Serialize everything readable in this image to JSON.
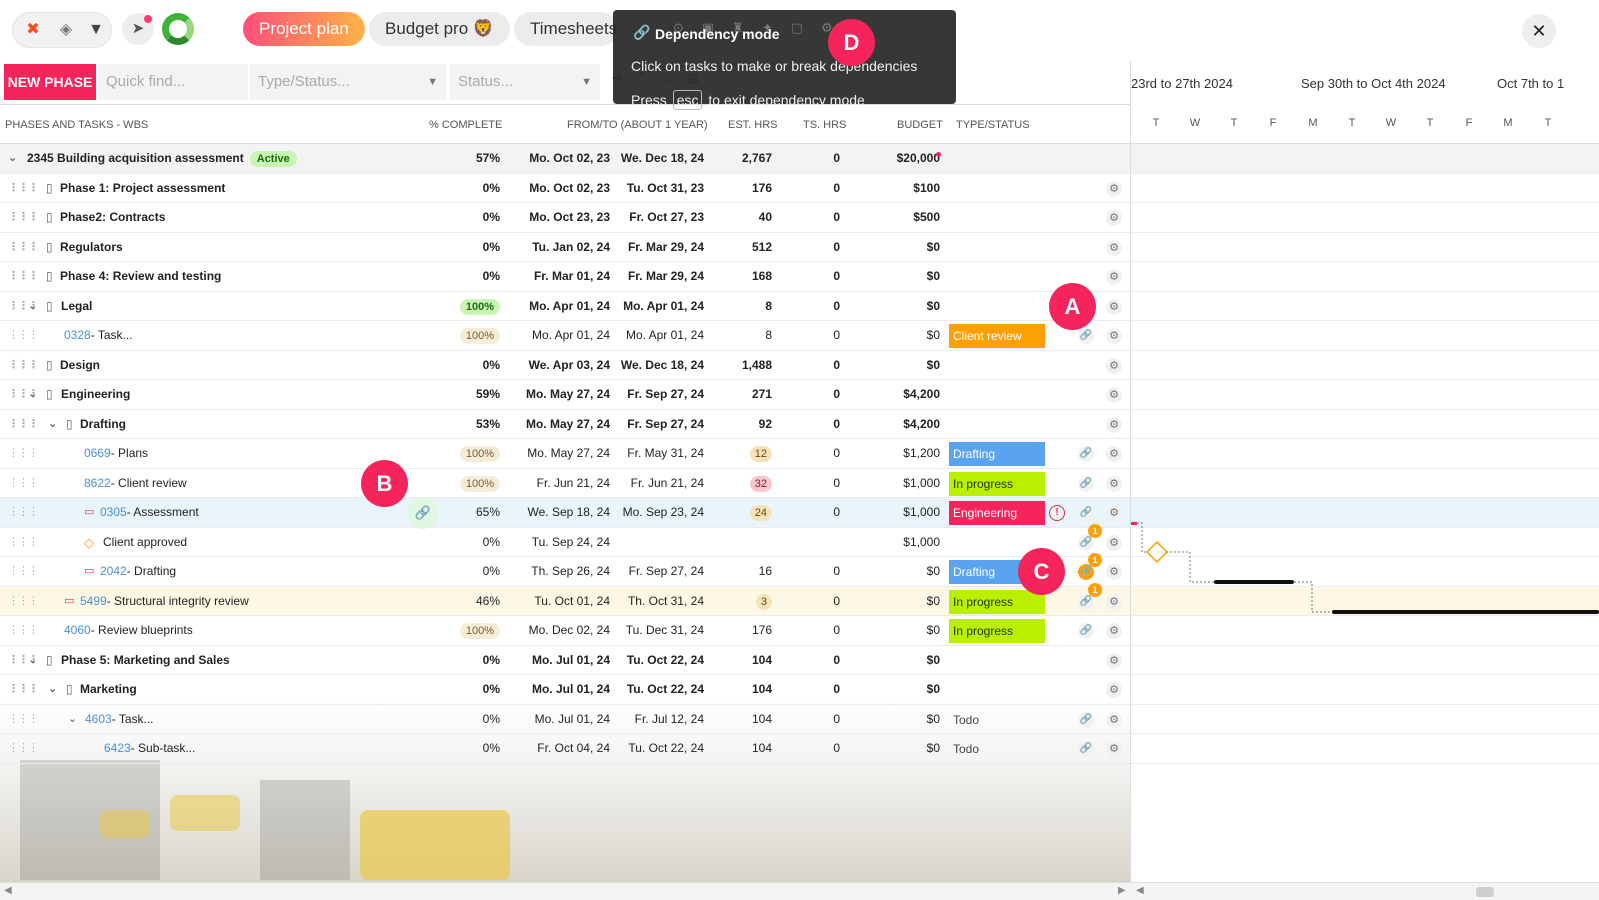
{
  "topbar": {
    "tabs": [
      {
        "label": "Project plan",
        "active": true
      },
      {
        "label": "Budget pro 🦁",
        "active": false
      },
      {
        "label": "Timesheets",
        "active": false
      }
    ],
    "icons": [
      "x-logo-icon",
      "layers-icon",
      "chevron-down-icon",
      "rocket-icon",
      "spinner-icon",
      "close-icon"
    ],
    "close_label": "✕"
  },
  "filters": {
    "new_phase_label": "NEW PHASE",
    "quick_find_placeholder": "Quick find...",
    "type_status_placeholder": "Type/Status...",
    "status_placeholder": "Status..."
  },
  "columns": {
    "wbs": "PHASES AND TASKS - WBS",
    "complete": "% COMPLETE",
    "fromto": "FROM/TO (ABOUT 1 YEAR)",
    "est": "EST. HRS",
    "ts": "TS. HRS",
    "budget": "BUDGET",
    "type": "TYPE/STATUS"
  },
  "gantt": {
    "weeks": [
      "23rd to 27th 2024",
      "Sep 30th to Oct 4th 2024",
      "Oct 7th to 1"
    ],
    "days": [
      "T",
      "W",
      "T",
      "F",
      "M",
      "T",
      "W",
      "T",
      "F",
      "M",
      "T"
    ]
  },
  "tooltip": {
    "title": "Dependency mode",
    "body": "Click on tasks to make or break dependencies",
    "esc_pre": "Press",
    "esc_key": "esc",
    "esc_post": "to exit dependency mode"
  },
  "markers": {
    "a": "A",
    "b": "B",
    "c": "C",
    "d": "D"
  },
  "rows": [
    {
      "name": "2345 Building acquisition assessment",
      "tag": "Active",
      "pct": "57%",
      "from": "Mo. Oct 02, 23",
      "to": "We. Dec 18, 24",
      "est": "2,767",
      "ts": "0",
      "budget": "$20,000"
    },
    {
      "name": "Phase 1: Project assessment",
      "pct": "0%",
      "from": "Mo. Oct 02, 23",
      "to": "Tu. Oct 31, 23",
      "est": "176",
      "ts": "0",
      "budget": "$100"
    },
    {
      "name": "Phase2: Contracts",
      "pct": "0%",
      "from": "Mo. Oct 23, 23",
      "to": "Fr. Oct 27, 23",
      "est": "40",
      "ts": "0",
      "budget": "$500"
    },
    {
      "name": "Regulators",
      "pct": "0%",
      "from": "Tu. Jan 02, 24",
      "to": "Fr. Mar 29, 24",
      "est": "512",
      "ts": "0",
      "budget": "$0"
    },
    {
      "name": "Phase 4: Review and testing",
      "pct": "0%",
      "from": "Fr. Mar 01, 24",
      "to": "Fr. Mar 29, 24",
      "est": "168",
      "ts": "0",
      "budget": "$0"
    },
    {
      "name": "Legal",
      "pct": "100%",
      "from": "Mo. Apr 01, 24",
      "to": "Mo. Apr 01, 24",
      "est": "8",
      "ts": "0",
      "budget": "$0"
    },
    {
      "num": "0328",
      "name": "- Task...",
      "pct": "100%",
      "from": "Mo. Apr 01, 24",
      "to": "Mo. Apr 01, 24",
      "est": "8",
      "ts": "0",
      "budget": "$0",
      "status": "Client review"
    },
    {
      "name": "Design",
      "pct": "0%",
      "from": "We. Apr 03, 24",
      "to": "We. Dec 18, 24",
      "est": "1,488",
      "ts": "0",
      "budget": "$0"
    },
    {
      "name": "Engineering",
      "pct": "59%",
      "from": "Mo. May 27, 24",
      "to": "Fr. Sep 27, 24",
      "est": "271",
      "ts": "0",
      "budget": "$4,200"
    },
    {
      "name": "Drafting",
      "pct": "53%",
      "from": "Mo. May 27, 24",
      "to": "Fr. Sep 27, 24",
      "est": "92",
      "ts": "0",
      "budget": "$4,200"
    },
    {
      "num": "0669",
      "name": "- Plans",
      "pct": "100%",
      "from": "Mo. May 27, 24",
      "to": "Fr. May 31, 24",
      "est": "12",
      "ts": "0",
      "budget": "$1,200",
      "status": "Drafting"
    },
    {
      "num": "8622",
      "name": "- Client review",
      "pct": "100%",
      "from": "Fr. Jun 21, 24",
      "to": "Fr. Jun 21, 24",
      "est": "32",
      "ts": "0",
      "budget": "$1,000",
      "status": "In progress"
    },
    {
      "num": "0305",
      "name": "- Assessment",
      "pct": "65%",
      "from": "We. Sep 18, 24",
      "to": "Mo. Sep 23, 24",
      "est": "24",
      "ts": "0",
      "budget": "$1,000",
      "status": "Engineering",
      "alert": "!"
    },
    {
      "name": "Client approved",
      "pct": "0%",
      "from": "Tu. Sep 24, 24",
      "to": "",
      "est": "",
      "ts": "",
      "budget": "$1,000",
      "badge": "1"
    },
    {
      "num": "2042",
      "name": "- Drafting",
      "pct": "0%",
      "from": "Th. Sep 26, 24",
      "to": "Fr. Sep 27, 24",
      "est": "16",
      "ts": "0",
      "budget": "$0",
      "status": "Drafting",
      "badge": "1"
    },
    {
      "num": "5499",
      "name": "- Structural integrity review",
      "pct": "46%",
      "from": "Tu. Oct 01, 24",
      "to": "Th. Oct 31, 24",
      "est": "3",
      "ts": "0",
      "budget": "$0",
      "status": "In progress",
      "badge": "1"
    },
    {
      "num": "4060",
      "name": "- Review blueprints",
      "pct": "100%",
      "from": "Mo. Dec 02, 24",
      "to": "Tu. Dec 31, 24",
      "est": "176",
      "ts": "0",
      "budget": "$0",
      "status": "In progress"
    },
    {
      "name": "Phase 5: Marketing and Sales",
      "pct": "0%",
      "from": "Mo. Jul 01, 24",
      "to": "Tu. Oct 22, 24",
      "est": "104",
      "ts": "0",
      "budget": "$0"
    },
    {
      "name": "Marketing",
      "pct": "0%",
      "from": "Mo. Jul 01, 24",
      "to": "Tu. Oct 22, 24",
      "est": "104",
      "ts": "0",
      "budget": "$0"
    },
    {
      "num": "4603",
      "name": "- Task...",
      "pct": "0%",
      "from": "Mo. Jul 01, 24",
      "to": "Fr. Jul 12, 24",
      "est": "104",
      "ts": "0",
      "budget": "$0",
      "status": "Todo"
    },
    {
      "num": "6423",
      "name": "- Sub-task...",
      "pct": "0%",
      "from": "Fr. Oct 04, 24",
      "to": "Tu. Oct 22, 24",
      "est": "104",
      "ts": "0",
      "budget": "$0",
      "status": "Todo"
    }
  ]
}
